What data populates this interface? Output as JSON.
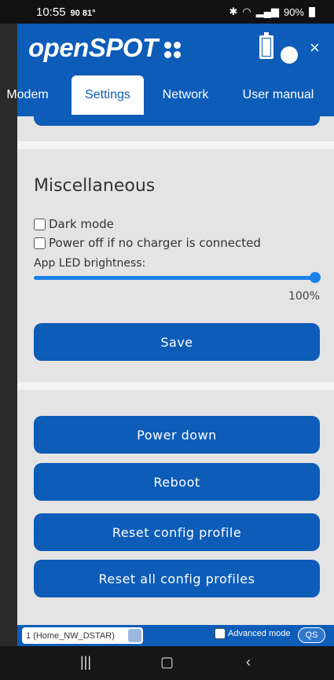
{
  "status_bar": {
    "time": "10:55",
    "extra": "90 81°",
    "icons": [
      "bluetooth-icon",
      "wifi-icon",
      "signal-icon"
    ],
    "battery": "90%"
  },
  "header": {
    "logo": "openSPOT",
    "close_icon": "×"
  },
  "tabs": [
    {
      "label": "Modem",
      "active": false
    },
    {
      "label": "Settings",
      "active": true
    },
    {
      "label": "Network",
      "active": false
    },
    {
      "label": "User manual",
      "active": false
    }
  ],
  "misc": {
    "title": "Miscellaneous",
    "dark_mode_label": "Dark mode",
    "dark_mode_checked": false,
    "power_off_label": "Power off if no charger is connected",
    "power_off_checked": false,
    "brightness_label": "App LED brightness:",
    "brightness_value": "100%",
    "brightness_fraction": 1.0,
    "save_label": "Save"
  },
  "actions": {
    "power_down": "Power down",
    "reboot": "Reboot",
    "reset_profile": "Reset config profile",
    "reset_all": "Reset all config profiles"
  },
  "footer": {
    "profile": "1 (Home_NW_DSTAR)",
    "advanced_label": "Advanced mode",
    "advanced_checked": false,
    "qs_label": "QS"
  },
  "colors": {
    "brand": "#0d5cb8",
    "slider": "#1a82e8"
  }
}
